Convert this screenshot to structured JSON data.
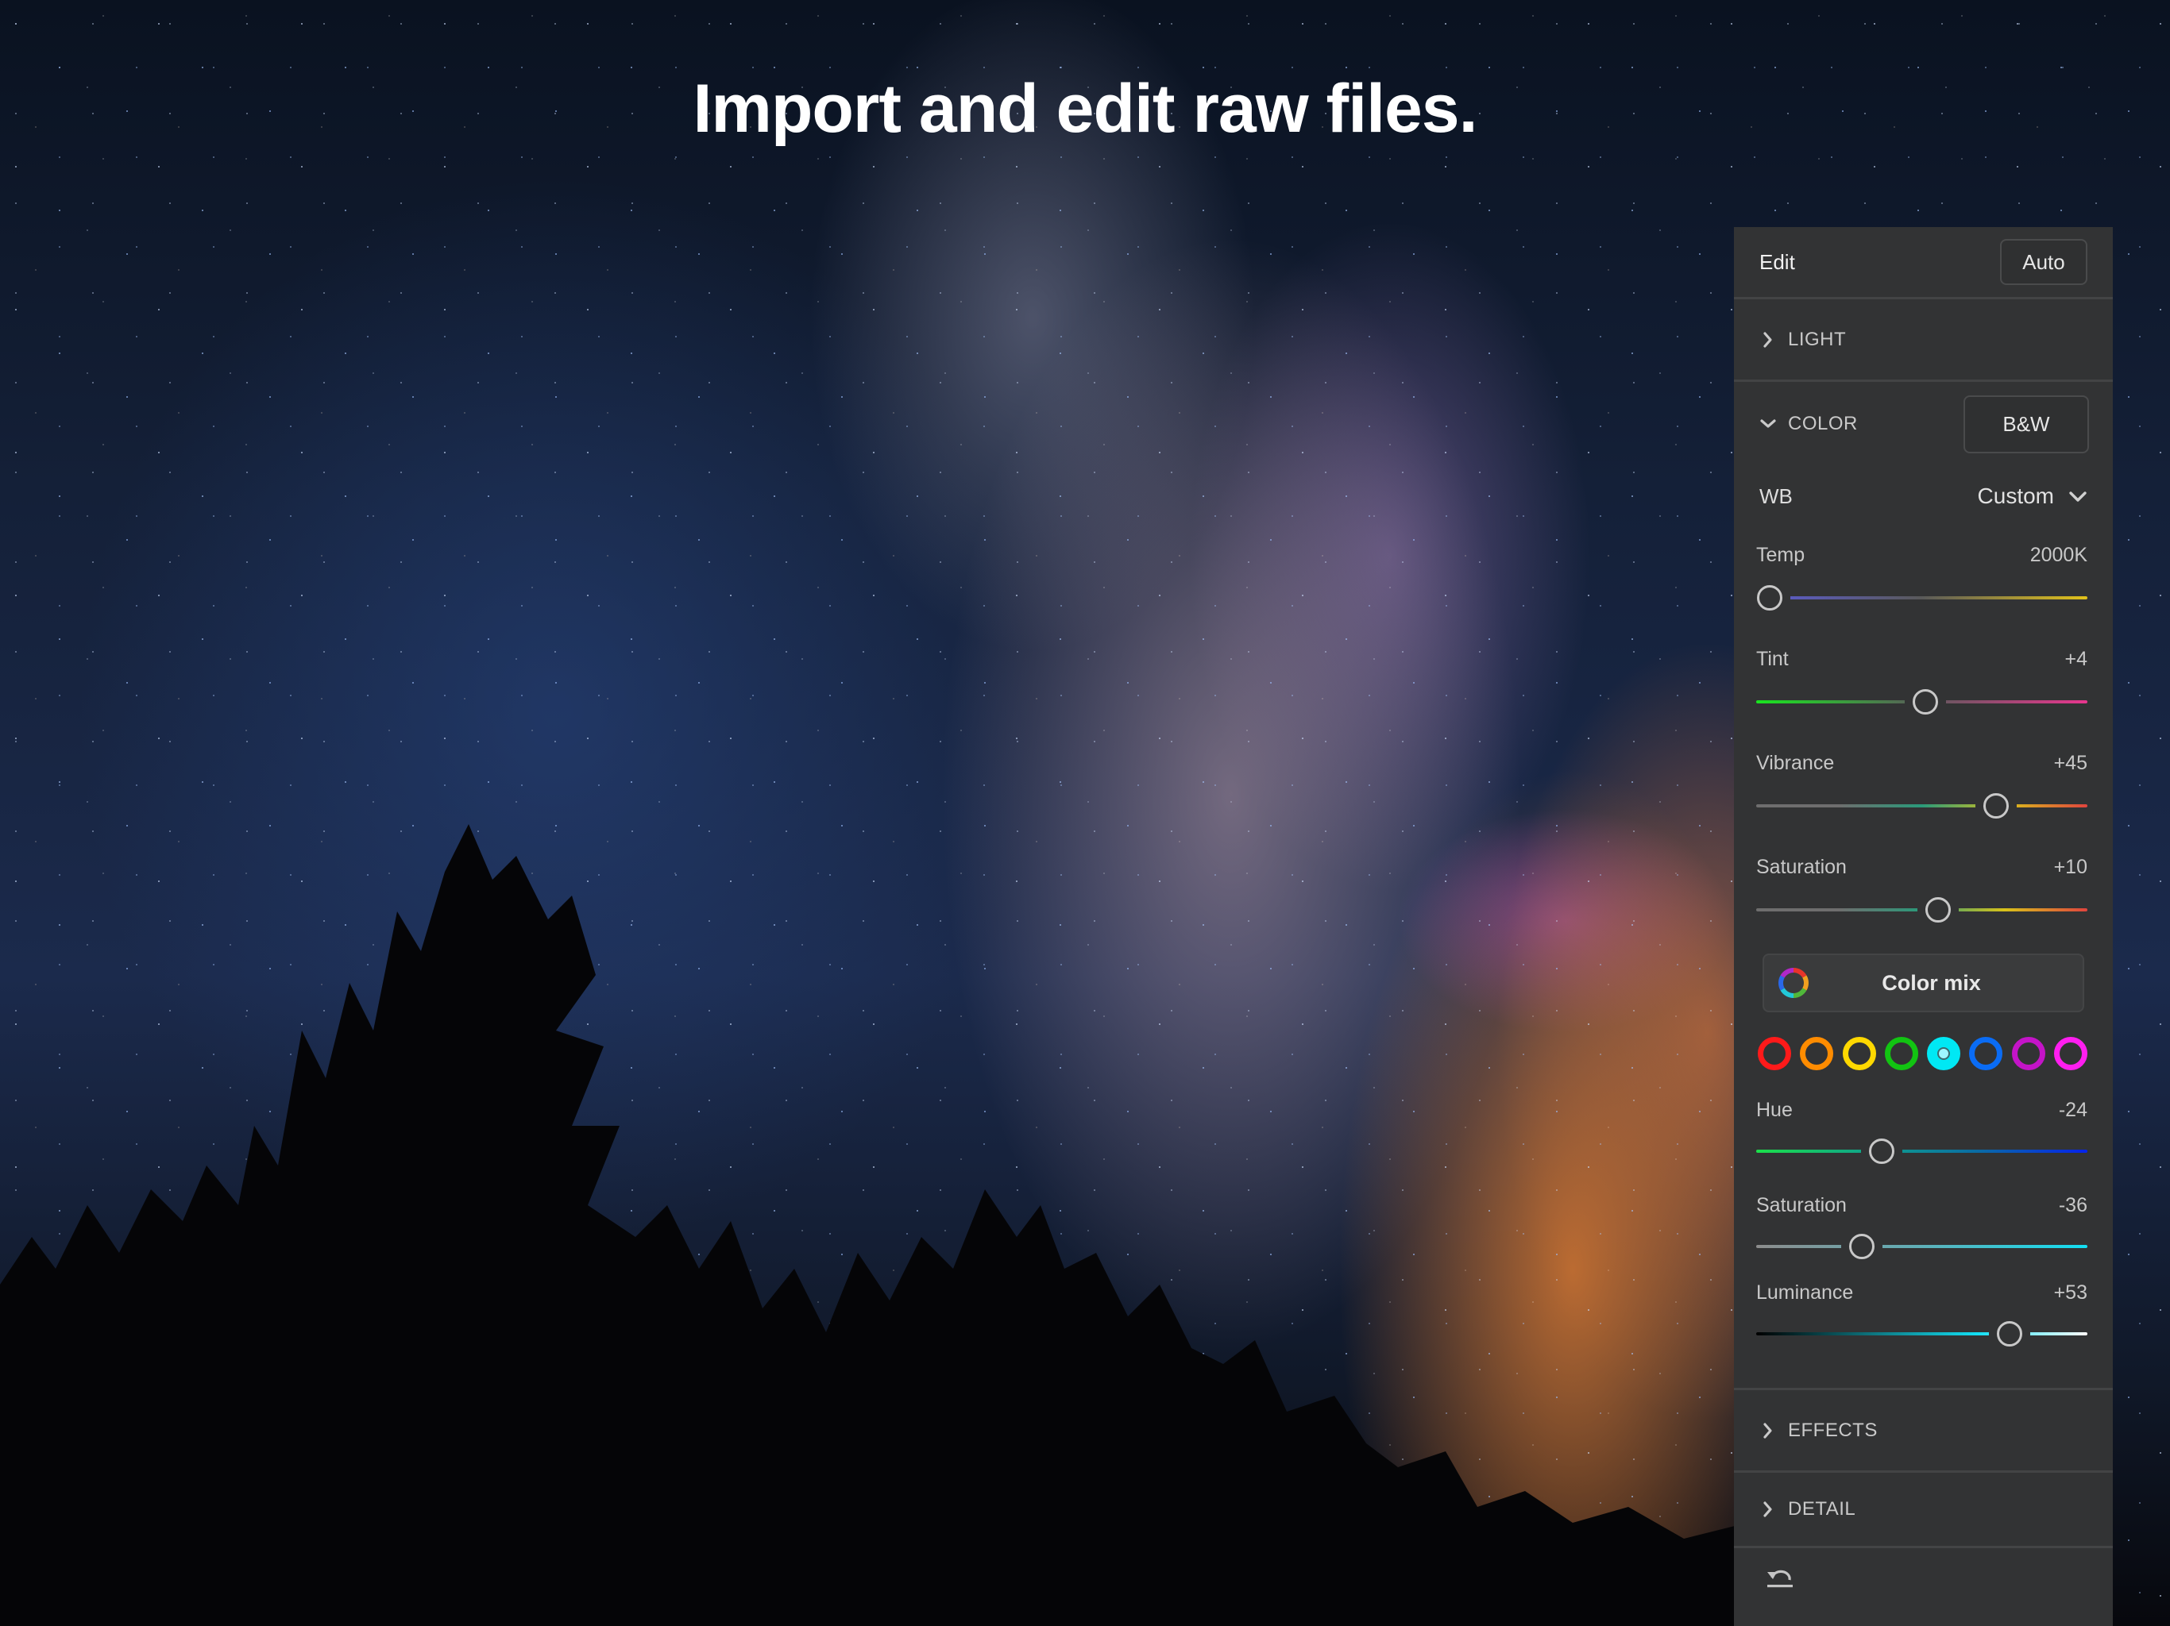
{
  "headline": "Import and edit raw files.",
  "panel": {
    "title": "Edit",
    "auto_label": "Auto",
    "sections": {
      "light": {
        "label": "LIGHT",
        "icon": "chevron-right-icon",
        "expanded": false
      },
      "color": {
        "label": "COLOR",
        "icon": "chevron-down-icon",
        "expanded": true,
        "bw_label": "B&W"
      },
      "effects": {
        "label": "EFFECTS",
        "icon": "chevron-right-icon",
        "expanded": false
      },
      "detail": {
        "label": "DETAIL",
        "icon": "chevron-right-icon",
        "expanded": false
      }
    },
    "wb": {
      "label": "WB",
      "value": "Custom",
      "icon": "chevron-down-icon"
    },
    "sliders": [
      {
        "id": "temp",
        "label": "Temp",
        "value": "2000K",
        "position": 0.04,
        "colors": [
          "#5b5bd6",
          "#5a5a5a",
          "#e2c21a"
        ]
      },
      {
        "id": "tint",
        "label": "Tint",
        "value": "+4",
        "position": 0.51,
        "colors": [
          "#19e51f",
          "#5a5a5a",
          "#e8368e"
        ]
      },
      {
        "id": "vibrance",
        "label": "Vibrance",
        "value": "+45",
        "position": 0.725,
        "colors": [
          "#6e6e6e",
          "#6e6e6e",
          "#2a9a7a",
          "#d8c21a",
          "#e0443e"
        ]
      },
      {
        "id": "saturation",
        "label": "Saturation",
        "value": "+10",
        "position": 0.55,
        "colors": [
          "#6e6e6e",
          "#6e6e6e",
          "#2a9a7a",
          "#d8c21a",
          "#e0443e"
        ]
      }
    ],
    "color_mix": {
      "label": "Color mix",
      "icon": "color-wheel-icon",
      "swatches": [
        {
          "name": "red",
          "color": "#ff1a1a",
          "selected": false
        },
        {
          "name": "orange",
          "color": "#ff8c00",
          "selected": false
        },
        {
          "name": "yellow",
          "color": "#ffd800",
          "selected": false
        },
        {
          "name": "green",
          "color": "#12c412",
          "selected": false
        },
        {
          "name": "aqua",
          "color": "#00e8f4",
          "selected": true
        },
        {
          "name": "blue",
          "color": "#0a6cf5",
          "selected": false
        },
        {
          "name": "purple",
          "color": "#c414c8",
          "selected": false
        },
        {
          "name": "magenta",
          "color": "#ff1ef0",
          "selected": false
        }
      ],
      "sliders": [
        {
          "id": "hue",
          "label": "Hue",
          "value": "-24",
          "position": 0.38,
          "colors": [
            "#1be04a",
            "#10a48a",
            "#0a6ca4",
            "#0522ec"
          ]
        },
        {
          "id": "hsl-saturation",
          "label": "Saturation",
          "value": "-36",
          "position": 0.32,
          "colors": [
            "#8c8c8c",
            "#5fb0b8",
            "#12def2"
          ]
        },
        {
          "id": "luminance",
          "label": "Luminance",
          "value": "+53",
          "position": 0.765,
          "colors": [
            "#000000",
            "#0d6f78",
            "#12def2",
            "#ffffff"
          ]
        }
      ]
    },
    "bottom": {
      "icon": "reset-icon"
    }
  }
}
